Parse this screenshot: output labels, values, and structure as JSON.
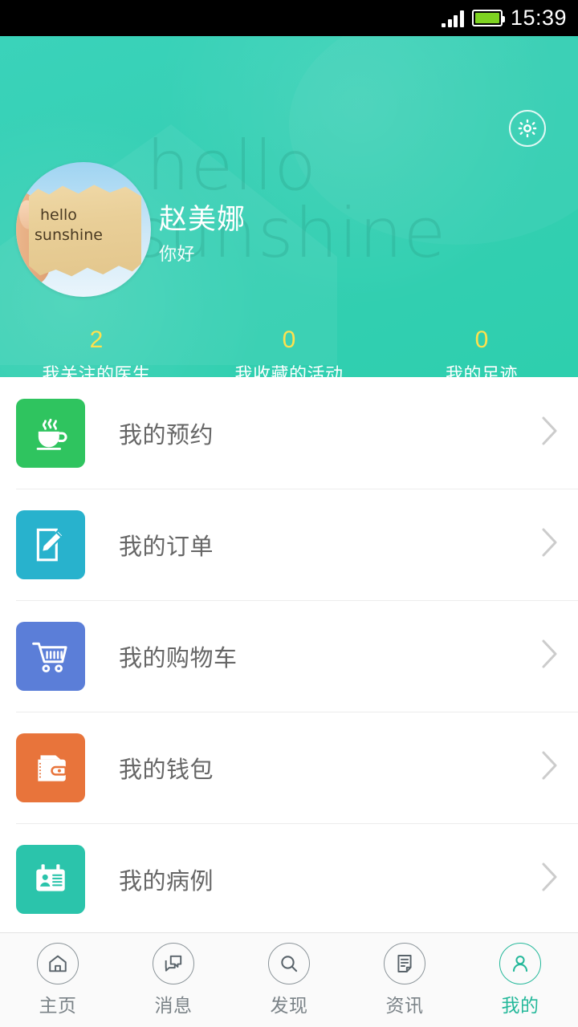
{
  "status_bar": {
    "time": "15:39",
    "signal_icon": "signal-bars-icon",
    "battery_icon": "battery-full-icon",
    "battery_color": "#7ed321"
  },
  "header": {
    "background_color": "#35cfb3",
    "watermark_line1": "hello",
    "watermark_line2": "sunshine",
    "settings_icon": "gear-icon",
    "avatar": {
      "icon": "avatar-photo",
      "caption_line1": "hello",
      "caption_line2": "sunshine"
    },
    "user_name": "赵美娜",
    "greeting": "你好",
    "stats": [
      {
        "value": "2",
        "label": "我关注的医生"
      },
      {
        "value": "0",
        "label": "我收藏的活动"
      },
      {
        "value": "0",
        "label": "我的足迹"
      }
    ],
    "stat_value_color": "#ffe14d"
  },
  "menu": {
    "items": [
      {
        "label": "我的预约",
        "icon": "coffee-cup-icon",
        "color": "#2fc45f",
        "chevron": "chevron-right-icon"
      },
      {
        "label": "我的订单",
        "icon": "edit-note-icon",
        "color": "#28b2cd",
        "chevron": "chevron-right-icon"
      },
      {
        "label": "我的购物车",
        "icon": "shopping-cart-icon",
        "color": "#5b7ed8",
        "chevron": "chevron-right-icon"
      },
      {
        "label": "我的钱包",
        "icon": "wallet-icon",
        "color": "#e8743b",
        "chevron": "chevron-right-icon"
      },
      {
        "label": "我的病例",
        "icon": "id-card-icon",
        "color": "#2bc4ab",
        "chevron": "chevron-right-icon"
      }
    ]
  },
  "tabbar": {
    "active_color": "#24b89a",
    "inactive_color": "#7a8287",
    "items": [
      {
        "label": "主页",
        "icon": "home-icon",
        "active": false
      },
      {
        "label": "消息",
        "icon": "chat-bubble-icon",
        "active": false
      },
      {
        "label": "发现",
        "icon": "search-icon",
        "active": false
      },
      {
        "label": "资讯",
        "icon": "document-icon",
        "active": false
      },
      {
        "label": "我的",
        "icon": "person-icon",
        "active": true
      }
    ]
  }
}
